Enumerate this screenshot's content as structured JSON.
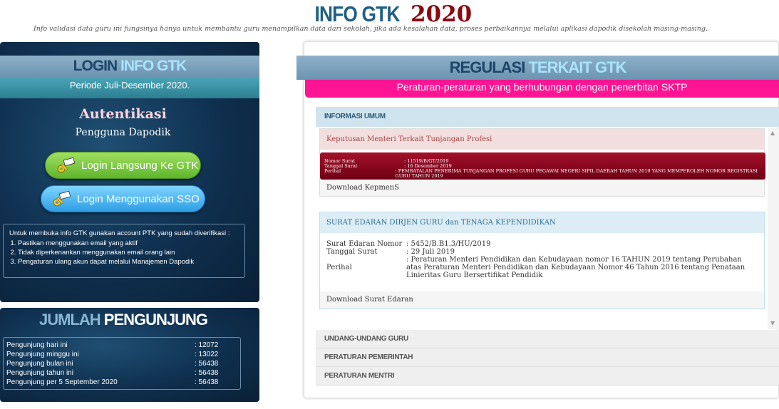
{
  "header": {
    "title_a": "INFO GTK",
    "title_b": "2020",
    "subtitle": "Info validasi data guru ini fungsinya hanya untuk membantu guru menampilkan data dari sekolah, jika ada kesalahan data, proses perbaikannya melalui aplikasi dapodik disekolah masing-masing."
  },
  "login": {
    "ribbon_a": "LOGIN",
    "ribbon_b": "INFO GTK",
    "period": "Periode Juli-Desember 2020.",
    "auth_title": "Autentikasi",
    "auth_sub": "Pengguna Dapodik",
    "btn_gtk": "Login Langsung Ke GTK",
    "btn_sso": "Login Menggunakan SSO",
    "info_intro": "Untuk membuka info GTK gunakan account PTK yang sudah diverifikasi :",
    "info_items": [
      "Pastikan menggunakan email yang aktif",
      "Tidak diperkenankan menggunakan email orang lain",
      "Pengaturan ulang akun dapat melalui Manajemen Dapodik"
    ]
  },
  "visitors": {
    "title_a": "JUMLAH",
    "title_b": "PENGUNJUNG",
    "rows": [
      {
        "label": "Pengunjung hari ini",
        "value": ": 12072"
      },
      {
        "label": "Pengunjung minggu ini",
        "value": ": 13022"
      },
      {
        "label": "Pengunjung bulan ini",
        "value": ": 56438"
      },
      {
        "label": "Pengunjung tahun ini",
        "value": ": 56438"
      },
      {
        "label": "Pengunjung per 5 September 2020",
        "value": ": 56438"
      }
    ]
  },
  "regulasi": {
    "ribbon_a": "REGULASI",
    "ribbon_b": "TERKAIT GTK",
    "pink": "Peraturan-peraturan yang berhubungan dengan penerbitan SKTP",
    "accordion": {
      "umum": "INFORMASI UMUM",
      "uu": "UNDANG-UNDANG GURU",
      "pp": "PERATURAN PEMERINTAH",
      "pm": "PERATURAN MENTRI"
    },
    "card1": {
      "head": "Keputusan Menteri Terkait Tunjangan Profesi",
      "nomor_k": "Nomor Surat",
      "nomor_v": ": 11519/B/GT/2019",
      "tanggal_k": "Tanggal Surat",
      "tanggal_v": ": 16 Desember 2019",
      "perihal_k": "Perihal",
      "perihal_v": ": PEMBATALAN PENERIMA TUNJANGAN PROFESI GURU PEGAWAI NEGERI SIPIL DAERAH TAHUN 2019 YANG MEMPEROLEH NOMOR REGISTRASI GURU TAHUN 2019",
      "download": "Download KepmenS"
    },
    "card2": {
      "head": "SURAT EDARAN DIRJEN GURU dan TENAGA KEPENDIDIKAN",
      "nomor_k": "Surat Edaran Nomor",
      "nomor_v": ": 5452/B.B1.3/HU/2019",
      "tanggal_k": "Tanggal Surat",
      "tanggal_v": ": 29 Juli 2019",
      "perihal_k": "Perihal",
      "perihal_v": ": Peraturan Menteri Pendidikan dan Kebudayaan nomor 16 TAHUN 2019 tentang Perubahan atas Peraturan Menteri Pendidikan dan Kebudayaan Nomor 46 Tahun 2016 tentang Penataan Linieritas Guru Bersertifikat Pendidik",
      "download": "Download Surat Edaran"
    }
  }
}
